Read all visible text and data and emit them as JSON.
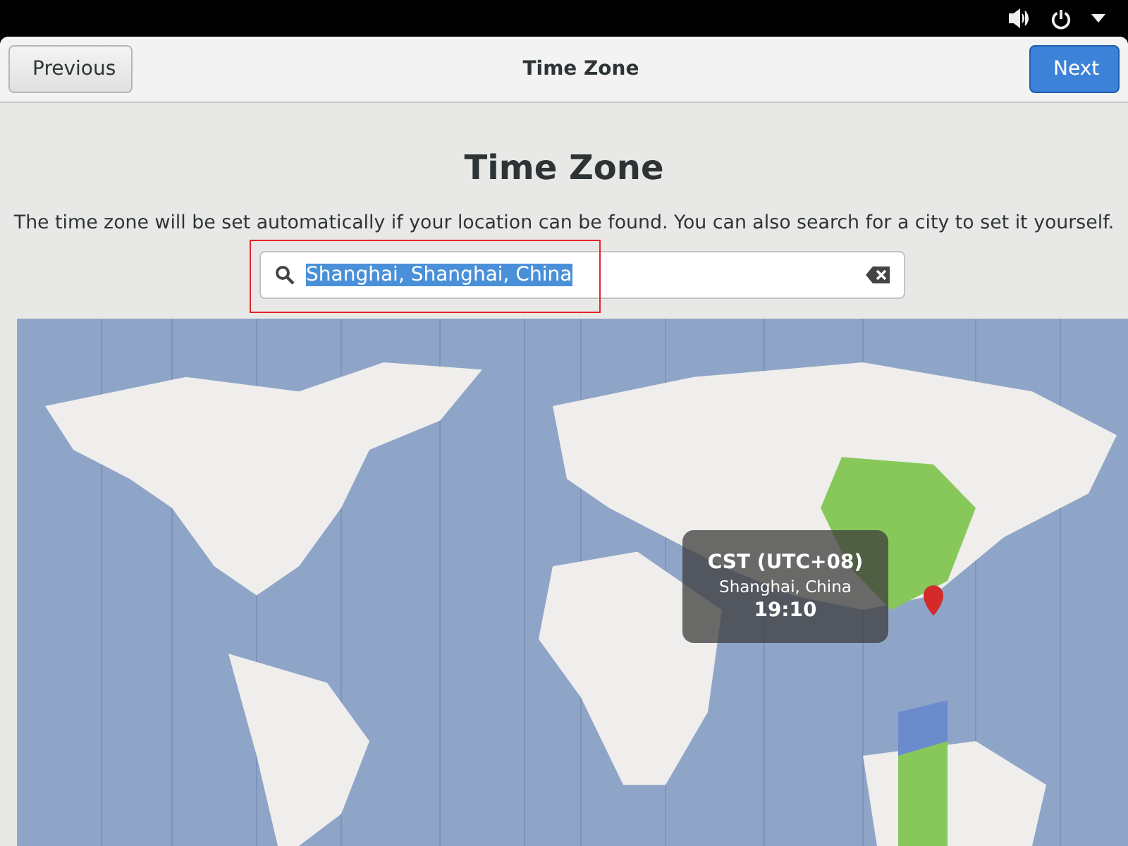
{
  "header": {
    "title": "Time Zone",
    "buttons": [
      {
        "label": "Previous",
        "kind": "secondary"
      },
      {
        "label": "Next",
        "kind": "primary"
      }
    ]
  },
  "heading": "Time Zone",
  "description": "The time zone will be set automatically if your location can be found. You can also search for a city to set it yourself.",
  "search": {
    "value": "Shanghai, Shanghai, China",
    "value_selected": true,
    "highlighted": true
  },
  "map": {
    "tooltip": {
      "zone": "CST (UTC+08)",
      "city": "Shanghai, China",
      "time": "19:10"
    }
  }
}
